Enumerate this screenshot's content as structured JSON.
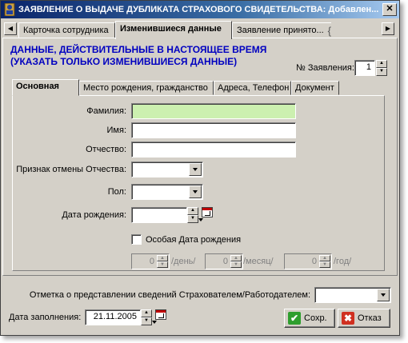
{
  "window": {
    "title": "ЗАЯВЛЕНИЕ О ВЫДАЧЕ ДУБЛИКАТА СТРАХОВОГО СВИДЕТЕЛЬСТВА: Добавлен..."
  },
  "tabs": [
    {
      "label": "Карточка сотрудника"
    },
    {
      "label": "Изменившиеся данные"
    },
    {
      "label": "Заявление принято..."
    }
  ],
  "heading": {
    "line1": "ДАННЫЕ, ДЕЙСТВИТЕЛЬНЫЕ В НАСТОЯЩЕЕ ВРЕМЯ",
    "line2": "(УКАЗАТЬ ТОЛЬКО ИЗМЕНИВШИЕСЯ ДАННЫЕ)"
  },
  "application_number": {
    "label": "№ Заявления:",
    "value": "1"
  },
  "inner_tabs": [
    {
      "label": "Основная"
    },
    {
      "label": "Место рождения, гражданство"
    },
    {
      "label": "Адреса, Телефон"
    },
    {
      "label": "Документ"
    }
  ],
  "form": {
    "surname_label": "Фамилия:",
    "surname_value": "",
    "name_label": "Имя:",
    "name_value": "",
    "patronymic_label": "Отчество:",
    "patronymic_value": "",
    "patronymic_cancel_label": "Признак отмены Отчества:",
    "patronymic_cancel_value": "",
    "gender_label": "Пол:",
    "gender_value": "",
    "birth_date_label": "Дата рождения:",
    "birth_date_value": "",
    "special_birth_date_label": "Особая Дата рождения",
    "special_birth_date_checked": false,
    "day_value": "0",
    "day_label": "/день/",
    "month_value": "0",
    "month_label": "/месяц/",
    "year_value": "0",
    "year_label": "/год/"
  },
  "footer": {
    "submission_label": "Отметка о представлении сведений Страхователем/Работодателем:",
    "submission_value": "",
    "fill_date_label": "Дата заполнения:",
    "fill_date_value": "21.11.2005",
    "save_label": "Сохр.",
    "cancel_label": "Отказ"
  },
  "colors": {
    "accent_heading": "#0000c0",
    "required_field": "#ccf0b0",
    "title_bar": "#0a246a"
  }
}
